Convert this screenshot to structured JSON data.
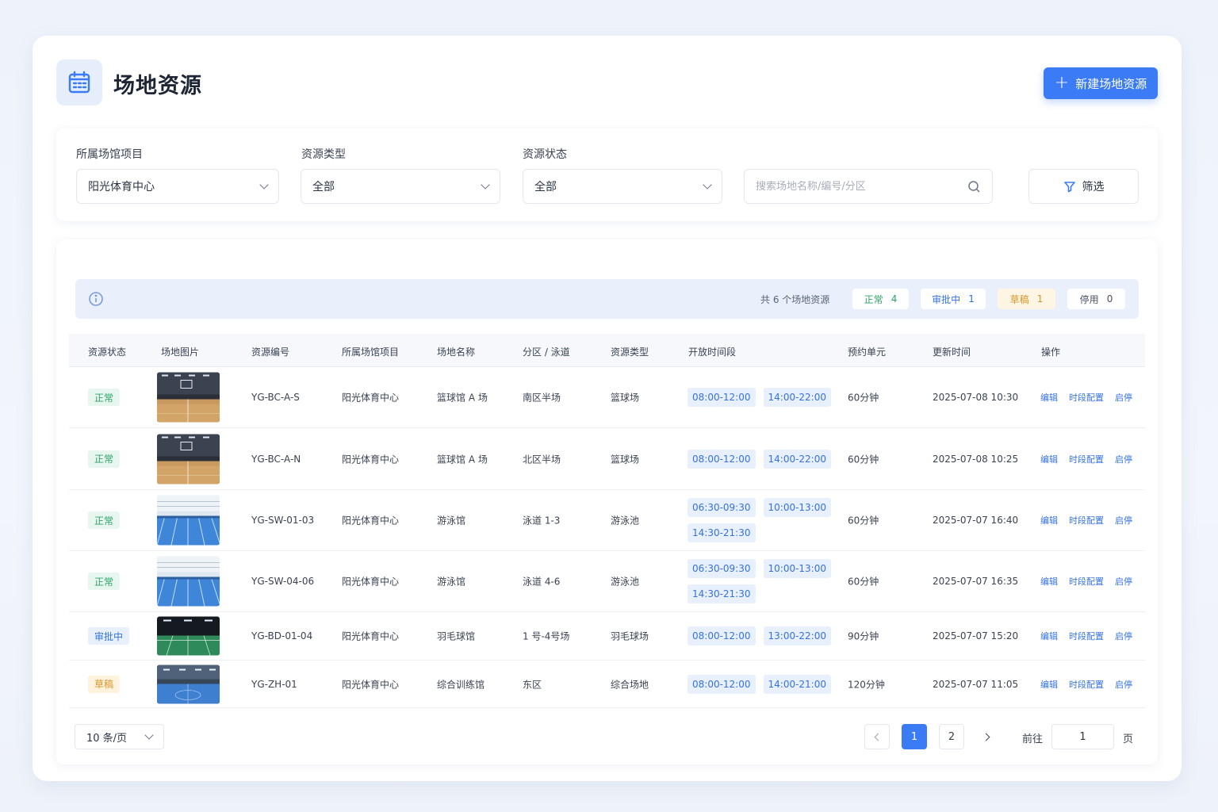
{
  "header": {
    "title": "场地资源",
    "new_button": "新建场地资源"
  },
  "filters": {
    "venue_label": "所属场馆项目",
    "venue_value": "阳光体育中心",
    "type_label": "资源类型",
    "type_value": "全部",
    "status_label": "资源状态",
    "status_value": "全部",
    "search_placeholder": "搜索场地名称/编号/分区",
    "filter_button": "筛选"
  },
  "summary": {
    "total": "共 6 个场地资源",
    "ok_label": "正常",
    "ok_count": "4",
    "review_label": "审批中",
    "review_count": "1",
    "draft_label": "草稿",
    "draft_count": "1",
    "stop_label": "停用",
    "stop_count": "0"
  },
  "columns": [
    "资源状态",
    "场地图片",
    "资源编号",
    "所属场馆项目",
    "场地名称",
    "分区 / 泳道",
    "资源类型",
    "开放时间段",
    "预约单元",
    "更新时间",
    "操作"
  ],
  "rows": [
    {
      "status": "正常",
      "status_type": "ok",
      "image": "basketball",
      "code": "YG-BC-A-S",
      "venue": "阳光体育中心",
      "name": "篮球馆 A 场",
      "zone": "南区半场",
      "type": "篮球场",
      "times": [
        "08:00-12:00",
        "14:00-22:00"
      ],
      "unit": "60分钟",
      "updated": "2025-07-08 10:30"
    },
    {
      "status": "正常",
      "status_type": "ok",
      "image": "basketball",
      "code": "YG-BC-A-N",
      "venue": "阳光体育中心",
      "name": "篮球馆 A 场",
      "zone": "北区半场",
      "type": "篮球场",
      "times": [
        "08:00-12:00",
        "14:00-22:00"
      ],
      "unit": "60分钟",
      "updated": "2025-07-08 10:25"
    },
    {
      "status": "正常",
      "status_type": "ok",
      "image": "pool",
      "code": "YG-SW-01-03",
      "venue": "阳光体育中心",
      "name": "游泳馆",
      "zone": "泳道 1-3",
      "type": "游泳池",
      "times": [
        "06:30-09:30",
        "10:00-13:00",
        "14:30-21:30"
      ],
      "unit": "60分钟",
      "updated": "2025-07-07 16:40"
    },
    {
      "status": "正常",
      "status_type": "ok",
      "image": "pool",
      "code": "YG-SW-04-06",
      "venue": "阳光体育中心",
      "name": "游泳馆",
      "zone": "泳道 4-6",
      "type": "游泳池",
      "times": [
        "06:30-09:30",
        "10:00-13:00",
        "14:30-21:30"
      ],
      "unit": "60分钟",
      "updated": "2025-07-07 16:35"
    },
    {
      "status": "审批中",
      "status_type": "rev",
      "image": "badminton",
      "code": "YG-BD-01-04",
      "venue": "阳光体育中心",
      "name": "羽毛球馆",
      "zone": "1 号-4号场",
      "type": "羽毛球场",
      "times": [
        "08:00-12:00",
        "13:00-22:00"
      ],
      "unit": "90分钟",
      "updated": "2025-07-07 15:20"
    },
    {
      "status": "草稿",
      "status_type": "draft",
      "image": "training",
      "code": "YG-ZH-01",
      "venue": "阳光体育中心",
      "name": "综合训练馆",
      "zone": "东区",
      "type": "综合场地",
      "times": [
        "08:00-12:00",
        "14:00-21:00"
      ],
      "unit": "120分钟",
      "updated": "2025-07-07 11:05"
    }
  ],
  "ops": [
    "编辑",
    "时段配置",
    "启停"
  ],
  "pagination": {
    "page_size": "10 条/页",
    "pages": [
      "1",
      "2"
    ],
    "goto_label": "前往",
    "goto_value": "1",
    "page_suffix": "页"
  }
}
